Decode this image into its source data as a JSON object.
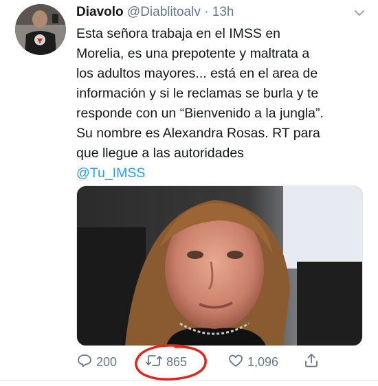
{
  "tweet": {
    "author_name": "Diavolo",
    "author_handle": "@Diablitoalv",
    "separator": "·",
    "timestamp": "13h",
    "text_lines": [
      "Esta señora trabaja en el IMSS en",
      "Morelia, es una prepotente y maltrata a",
      "los adultos mayores... está en el area de",
      "información y si le reclamas se burla y te",
      "responde con un “Bienvenido a la jungla”.",
      "Su nombre es Alexandra Rosas. RT para",
      "que llegue a las autoridades"
    ],
    "mention": "@Tu_IMSS"
  },
  "actions": {
    "reply_count": "200",
    "retweet_count": "865",
    "like_count": "1,096"
  },
  "colors": {
    "text": "#14171a",
    "secondary": "#657786",
    "link": "#1da1f2",
    "annotation": "#e0261b"
  },
  "icons": [
    "caret-down-icon",
    "reply-icon",
    "retweet-icon",
    "heart-icon",
    "share-icon"
  ]
}
